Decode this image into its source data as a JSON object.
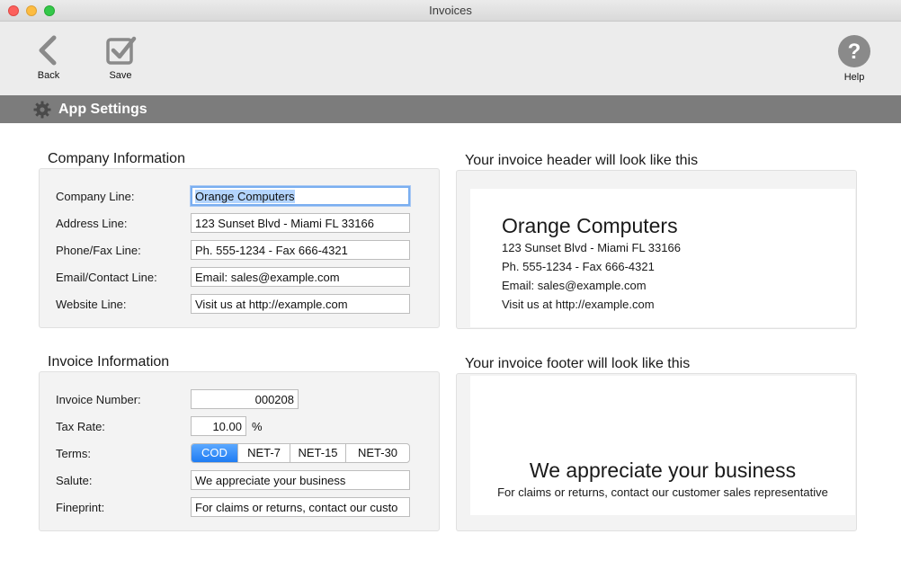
{
  "window": {
    "title": "Invoices"
  },
  "toolbar": {
    "back_label": "Back",
    "save_label": "Save",
    "help_label": "Help"
  },
  "section": {
    "title": "App Settings"
  },
  "company": {
    "title": "Company Information",
    "company_label": "Company Line:",
    "company_value": "Orange Computers",
    "address_label": "Address Line:",
    "address_value": "123 Sunset Blvd - Miami FL 33166",
    "phone_label": "Phone/Fax Line:",
    "phone_value": "Ph. 555-1234 - Fax 666-4321",
    "email_label": "Email/Contact Line:",
    "email_value": "Email: sales@example.com",
    "website_label": "Website Line:",
    "website_value": "Visit us at http://example.com"
  },
  "invoice": {
    "title": "Invoice Information",
    "number_label": "Invoice Number:",
    "number_value": "000208",
    "tax_label": "Tax Rate:",
    "tax_value": "10.00",
    "tax_unit": "%",
    "terms_label": "Terms:",
    "terms_options": [
      "COD",
      "NET-7",
      "NET-15",
      "NET-30"
    ],
    "terms_selected": "COD",
    "salute_label": "Salute:",
    "salute_value": "We appreciate your business",
    "fineprint_label": "Fineprint:",
    "fineprint_value": "For claims or returns, contact our custo"
  },
  "header_preview": {
    "title": "Your invoice header will look like this",
    "company": "Orange Computers",
    "address": "123 Sunset Blvd - Miami FL 33166",
    "phone": "Ph. 555-1234 - Fax 666-4321",
    "email": "Email: sales@example.com",
    "website": "Visit us at http://example.com"
  },
  "footer_preview": {
    "title": "Your invoice footer will look like this",
    "salute": "We appreciate your business",
    "fineprint": "For claims or returns, contact our customer sales representative"
  },
  "colors": {
    "accent": "#1e7cf3",
    "section_bar": "#7c7c7c",
    "focus_ring": "#7aaef0"
  }
}
